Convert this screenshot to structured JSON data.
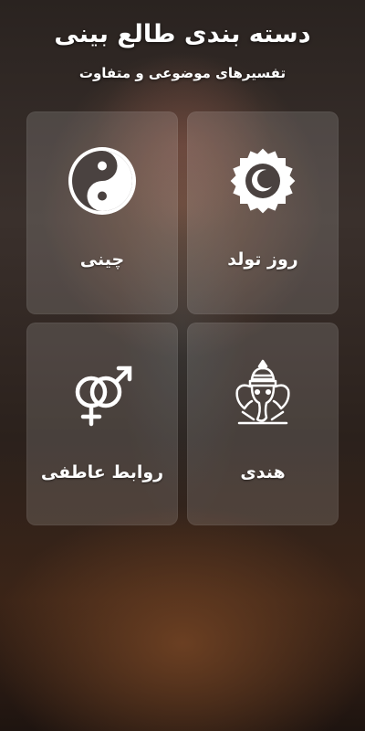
{
  "header": {
    "title": "دسته بندی طالع بینی",
    "subtitle": "تفسیرهای موضوعی و متفاوت"
  },
  "categories": [
    {
      "label": "روز تولد",
      "icon": "sun-moon-icon"
    },
    {
      "label": "چینی",
      "icon": "yin-yang-icon"
    },
    {
      "label": "هندی",
      "icon": "ganesha-icon"
    },
    {
      "label": "روابط عاطفی",
      "icon": "gender-symbols-icon"
    }
  ],
  "colors": {
    "text": "#ffffff",
    "card_background": "rgba(255,255,255,0.14)"
  }
}
